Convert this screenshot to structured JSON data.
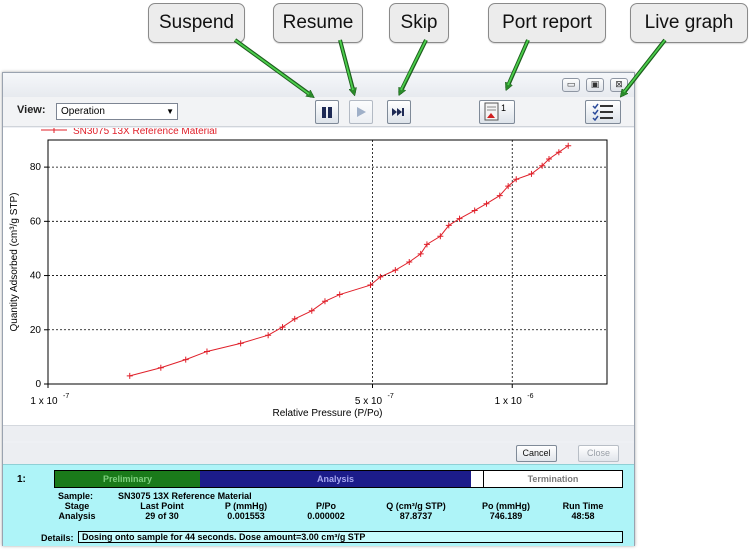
{
  "callouts": {
    "suspend": "Suspend",
    "resume": "Resume",
    "skip": "Skip",
    "port_report": "Port report",
    "live_graph": "Live graph"
  },
  "window": {
    "controls": {
      "minimize": "▭",
      "maximize": "▣",
      "close": "⊠"
    }
  },
  "toolbar": {
    "view_label": "View:",
    "view_selected": "Operation",
    "port_report_badge": "1"
  },
  "chart_data": {
    "type": "line",
    "title": "",
    "xlabel": "Relative Pressure (P/Po)",
    "ylabel": "Quantity Adsorbed (cm³/g STP)",
    "xscale": "log",
    "xlim": [
      1e-07,
      1.6e-06
    ],
    "ylim": [
      0,
      90
    ],
    "grid": true,
    "legend": "top-left",
    "x_ticks": [
      {
        "value": 1e-07,
        "label": "1 x 10",
        "exp": "-7"
      },
      {
        "value": 5e-07,
        "label": "5 x 10",
        "exp": "-7"
      },
      {
        "value": 1e-06,
        "label": "1 x 10",
        "exp": "-6"
      }
    ],
    "y_ticks": [
      0,
      20,
      40,
      60,
      80
    ],
    "series": [
      {
        "name": "SN3075 13X Reference Material",
        "color": "#e0202a",
        "x": [
          1.5e-07,
          1.75e-07,
          1.98e-07,
          2.2e-07,
          2.6e-07,
          2.98e-07,
          3.2e-07,
          3.4e-07,
          3.7e-07,
          3.95e-07,
          4.25e-07,
          4.95e-07,
          5.2e-07,
          5.6e-07,
          6e-07,
          6.35e-07,
          6.55e-07,
          7e-07,
          7.3e-07,
          7.7e-07,
          8.3e-07,
          8.8e-07,
          9.4e-07,
          9.8e-07,
          1.02e-06,
          1.1e-06,
          1.16e-06,
          1.2e-06,
          1.26e-06,
          1.32e-06
        ],
        "y": [
          3.0,
          6.0,
          9.0,
          12.0,
          15.0,
          18.0,
          21.0,
          24.0,
          27.0,
          30.5,
          33.0,
          36.5,
          39.5,
          42.0,
          45.0,
          48.0,
          51.5,
          54.5,
          58.5,
          61.0,
          64.0,
          66.5,
          69.5,
          73.0,
          75.5,
          77.5,
          80.5,
          83.0,
          85.5,
          87.8737
        ]
      }
    ]
  },
  "buttons": {
    "cancel": "Cancel",
    "close": "Close"
  },
  "status": {
    "port_number": "1:",
    "phases": {
      "preliminary": "Preliminary",
      "analysis": "Analysis",
      "termination": "Termination"
    },
    "sample_label": "Sample:",
    "sample_value": "SN3075 13X Reference Material",
    "columns": [
      {
        "header": "Stage",
        "value": "Analysis"
      },
      {
        "header": "Last Point",
        "value": "29 of 30"
      },
      {
        "header": "P (mmHg)",
        "value": "0.001553"
      },
      {
        "header": "P/Po",
        "value": "0.000002"
      },
      {
        "header": "Q (cm³/g STP)",
        "value": "87.8737"
      },
      {
        "header": "Po (mmHg)",
        "value": "746.189"
      },
      {
        "header": "Run Time",
        "value": "48:58"
      }
    ],
    "details_label": "Details:",
    "details_value": "Dosing onto sample for 44 seconds. Dose amount=3.00 cm³/g STP",
    "colors": {
      "preliminary": "#1a7a1a",
      "analysis": "#1c1c8a",
      "termination": "#ffffff",
      "background": "#aef4f8"
    }
  }
}
